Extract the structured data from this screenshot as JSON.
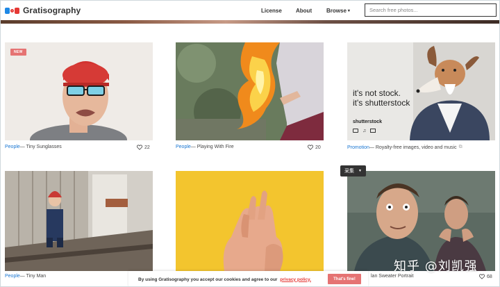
{
  "header": {
    "brand": "Gratisography",
    "nav": {
      "license": "License",
      "about": "About",
      "browse": "Browse"
    },
    "search": {
      "placeholder": "Search free photos..."
    }
  },
  "photos": [
    {
      "category": "People",
      "title": " — Tiny Sunglasses",
      "likes": "22",
      "badge": "NEW"
    },
    {
      "category": "People",
      "title": " — Playing With Fire",
      "likes": "20"
    },
    {
      "category": "Promotion",
      "title": " — Royalty-free images, video and music",
      "promo_text_1": "it's not stock.",
      "promo_text_2": "it's shutterstock",
      "promo_logo": "shutterstock"
    },
    {
      "category": "People",
      "title": " — Tiny Man"
    },
    {
      "category": "",
      "title": ""
    },
    {
      "category": "",
      "title": "lan Sweater Portrait",
      "likes": "68"
    }
  ],
  "collect_button": {
    "label": "采集"
  },
  "cookie_bar": {
    "text": "By using Gratisography you accept our cookies and agree to our",
    "link": "privacy policy.",
    "button": "That's fine!"
  },
  "watermark": "知乎 @刘凯强",
  "colors": {
    "accent_blue": "#1976d2",
    "accent_red": "#e57373"
  }
}
